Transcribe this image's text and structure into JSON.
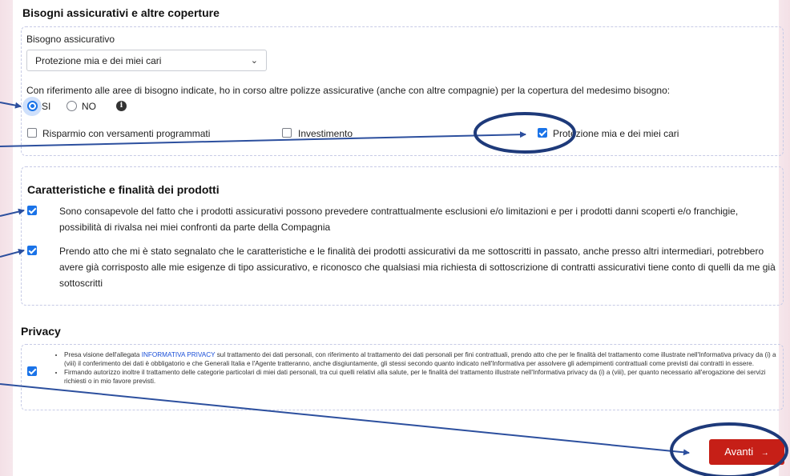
{
  "bisogni": {
    "title": "Bisogni assicurativi e altre coperture",
    "need_label": "Bisogno assicurativo",
    "need_value": "Protezione mia e dei miei cari",
    "question": "Con riferimento alle aree di bisogno indicate, ho in corso altre polizze assicurative (anche con altre compagnie) per la copertura del medesimo bisogno:",
    "radio_yes": "SI",
    "radio_no": "NO",
    "selected": "SI",
    "checkboxes": [
      {
        "label": "Risparmio con versamenti programmati",
        "checked": false
      },
      {
        "label": "Investimento",
        "checked": false
      },
      {
        "label": "Protezione mia e dei miei cari",
        "checked": true
      }
    ]
  },
  "caratteristiche": {
    "title": "Caratteristiche e finalità dei prodotti",
    "items": [
      {
        "text": "Sono consapevole del fatto che i prodotti assicurativi possono prevedere contrattualmente esclusioni e/o limitazioni e per i prodotti danni scoperti e/o franchigie, possibilità di rivalsa nei miei confronti da parte della Compagnia",
        "checked": true
      },
      {
        "text": "Prendo atto che mi è stato segnalato che le caratteristiche e le finalità dei prodotti assicurativi da me sottoscritti in passato, anche presso altri intermediari, potrebbero avere già corrisposto alle mie esigenze di tipo assicurativo, e riconosco che qualsiasi mia richiesta di sottoscrizione di contratti assicurativi tiene conto di quelli da me già sottoscritti",
        "checked": true
      }
    ]
  },
  "privacy": {
    "title": "Privacy",
    "checked": true,
    "bullet1_pre": "Presa visione dell'allegata ",
    "bullet1_link": "INFORMATIVA PRIVACY",
    "bullet1_post": " sul trattamento dei dati personali, con riferimento al trattamento dei dati personali per fini contrattuali, prendo atto che per le finalità del trattamento come illustrate nell'Informativa privacy da (i) a (viii) il conferimento dei dati è obbligatorio e che Generali Italia e l'Agente tratteranno, anche disgiuntamente, gli stessi secondo quanto indicato nell'Informativa per assolvere gli adempimenti contrattuali come previsti dai contratti in essere.",
    "bullet2": "Firmando autorizzo inoltre il trattamento delle categorie particolari di miei dati personali, tra cui quelli relativi alla salute, per le finalità del trattamento illustrate nell'Informativa privacy da (i) a (viii), per quanto necessario all'erogazione dei servizi richiesti o in mio favore previsti."
  },
  "footer": {
    "next_label": "Avanti",
    "next_arrow": "→"
  },
  "colors": {
    "accent": "#1a73e8",
    "button": "#c61f17",
    "annotation": "#2c4f9e"
  },
  "icons": [
    "chevron-down-icon",
    "info-icon",
    "arrow-right-icon"
  ]
}
